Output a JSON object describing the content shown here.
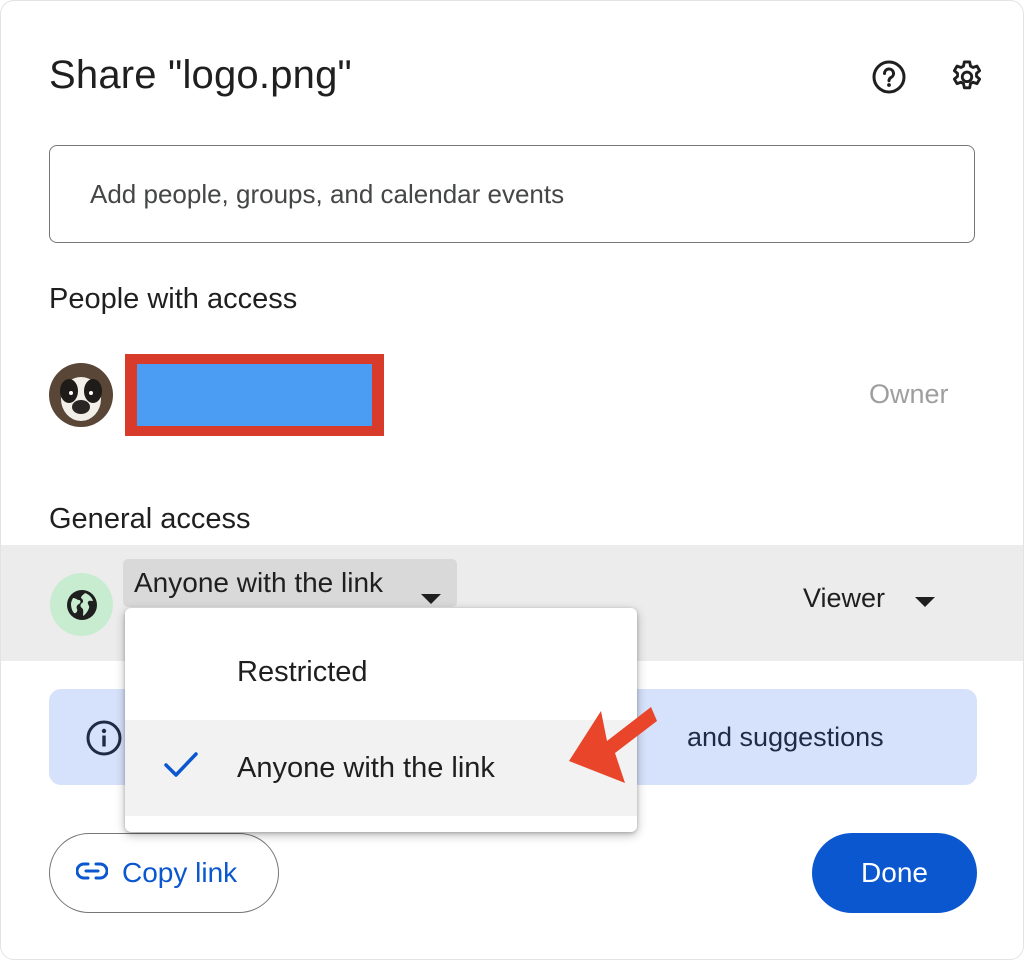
{
  "dialog": {
    "title": "Share \"logo.png\"",
    "help_icon": "help-circle-icon",
    "settings_icon": "gear-icon"
  },
  "add_people": {
    "placeholder": "Add people, groups, and calendar events",
    "value": ""
  },
  "people_with_access": {
    "heading": "People with access",
    "entries": [
      {
        "name_redacted": true,
        "role": "Owner"
      }
    ]
  },
  "general_access": {
    "heading": "General access",
    "selected": "Anyone with the link",
    "role": "Viewer",
    "icon": "globe-icon"
  },
  "access_menu": {
    "options": [
      {
        "label": "Restricted",
        "checked": false
      },
      {
        "label": "Anyone with the link",
        "checked": true
      }
    ]
  },
  "info_banner": {
    "visible_text": "and suggestions",
    "icon": "info-icon"
  },
  "footer": {
    "copy_link_label": "Copy link",
    "done_label": "Done"
  },
  "colors": {
    "primary": "#0b57d0",
    "info_bg": "#d6e2fb",
    "globe_bg": "#c8ecd0",
    "redaction_border": "#d93b2a",
    "redaction_fill": "#4a9df3",
    "annotation_arrow": "#e8452a"
  }
}
